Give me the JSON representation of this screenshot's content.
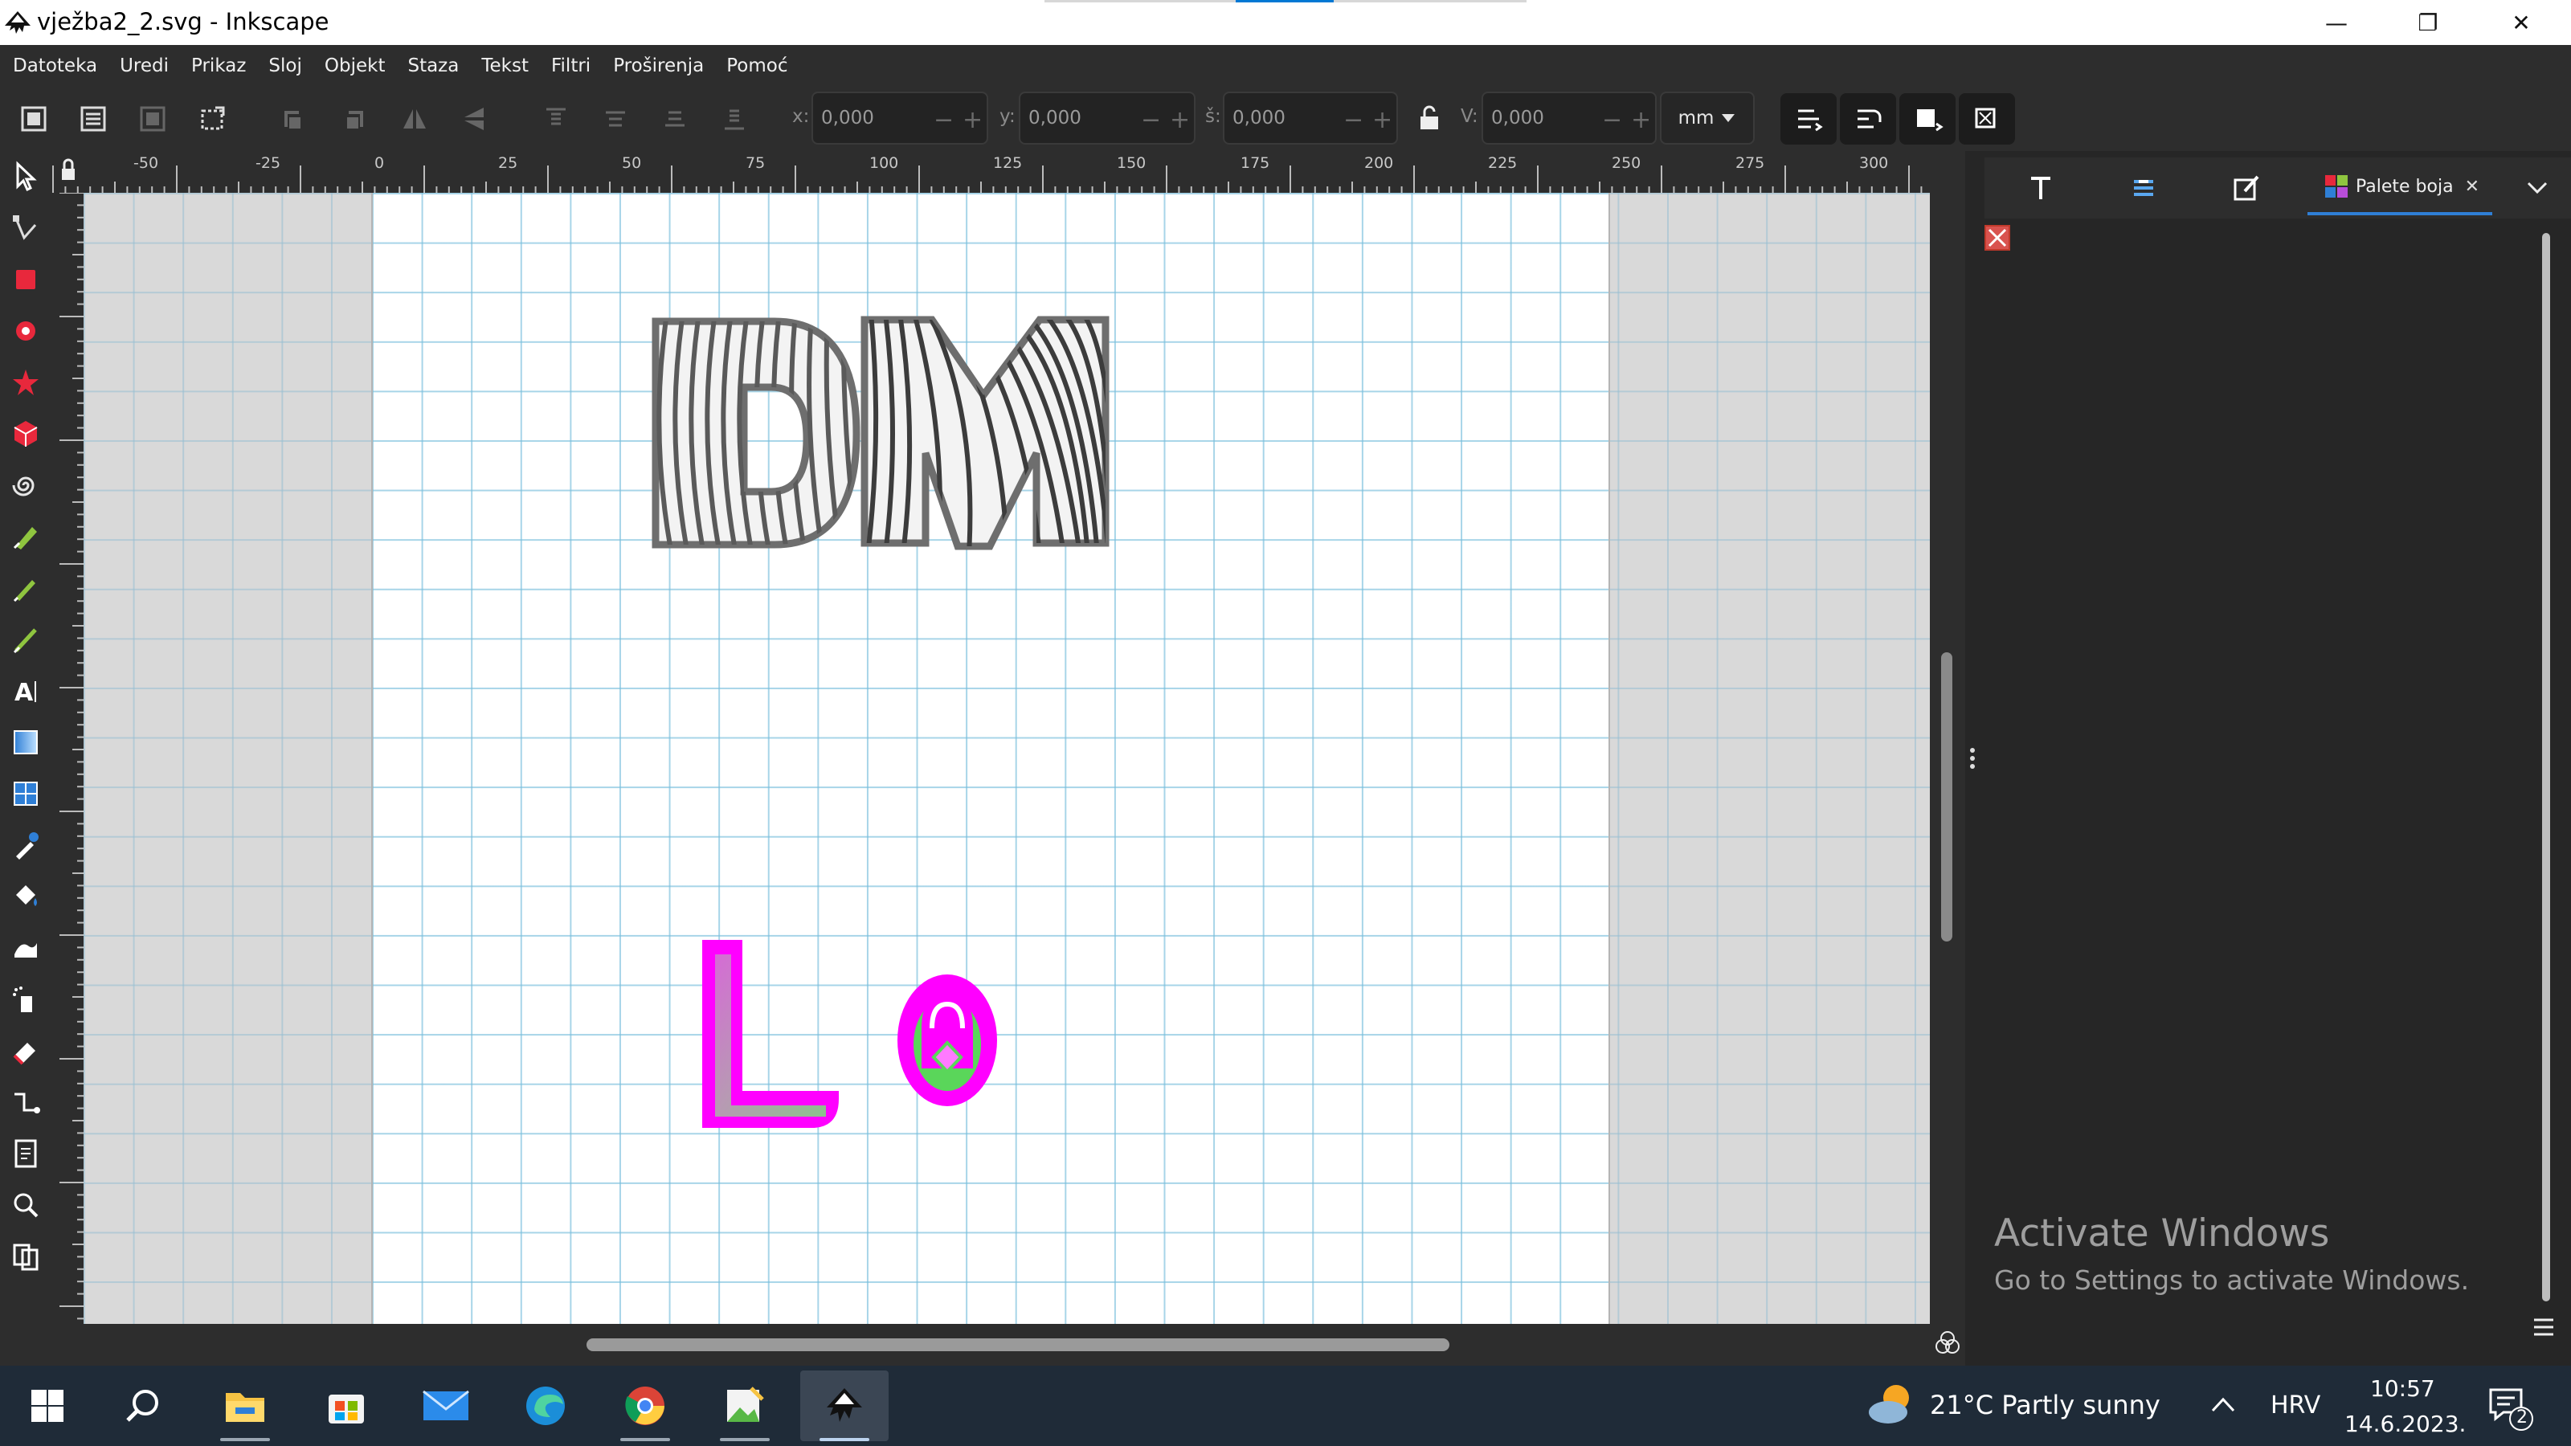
{
  "window": {
    "title": "vježba2_2.svg - Inkscape",
    "buttons": {
      "minimize": "—",
      "restore": "❐",
      "close": "✕"
    }
  },
  "menu": [
    "Datoteka",
    "Uredi",
    "Prikaz",
    "Sloj",
    "Objekt",
    "Staza",
    "Tekst",
    "Filtri",
    "Proširenja",
    "Pomoć"
  ],
  "controls": {
    "x_label": "x:",
    "x_value": "0,000",
    "y_label": "y:",
    "y_value": "0,000",
    "w_label": "š:",
    "w_value": "0,000",
    "h_label": "V:",
    "h_value": "0,000",
    "unit": "mm"
  },
  "ruler": {
    "top_labels": [
      "-50",
      "-25",
      "0",
      "25",
      "50",
      "75",
      "100",
      "125",
      "150",
      "175",
      "200",
      "225",
      "250",
      "275",
      "300"
    ]
  },
  "dock": {
    "active_tab": "Palete boja",
    "close": "✕",
    "tabs": [
      "text-font-icon",
      "layers-icon",
      "fill-stroke-icon",
      "swatches-icon"
    ]
  },
  "watermark": {
    "title": "Activate Windows",
    "subtitle": "Go to Settings to activate Windows."
  },
  "taskbar": {
    "weather": "21°C  Partly sunny",
    "language": "HRV",
    "time": "10:57",
    "date": "14.6.2023.",
    "notification_count": "2"
  },
  "colors": {
    "chrome_dark": "#2d2d2d",
    "dock_bg": "#262626",
    "taskbar_bg": "#1f2b38",
    "accent_blue": "#2f7fd6",
    "magenta": "#ff00ff",
    "green": "#4cd44c"
  }
}
